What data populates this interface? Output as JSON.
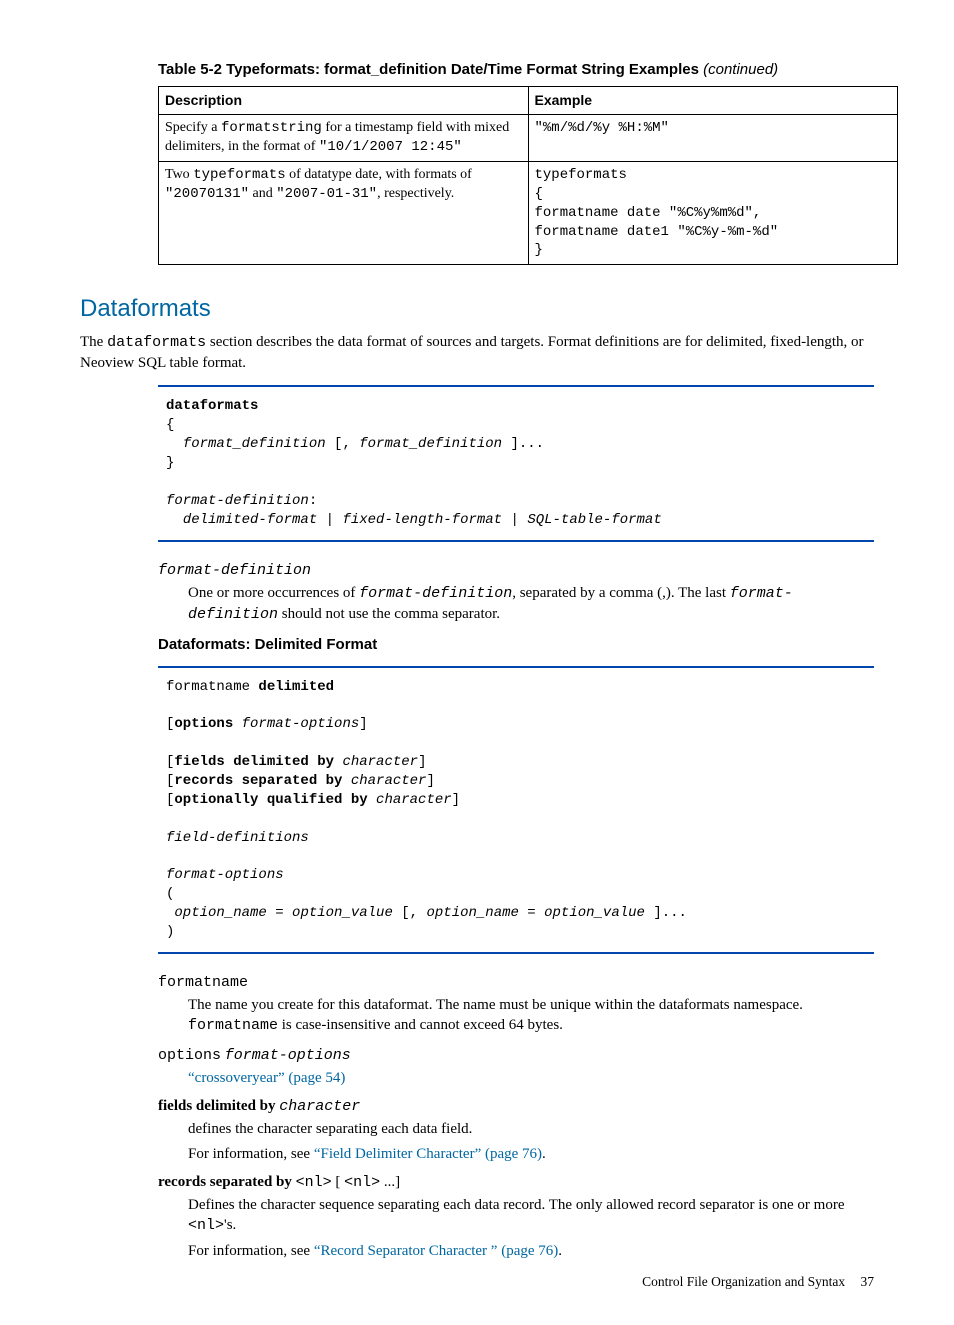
{
  "table": {
    "caption_prefix": "Table 5-2 Typeformats: format_definition Date/Time Format String Examples",
    "caption_suffix": "(continued)",
    "headers": {
      "desc": "Description",
      "ex": "Example"
    },
    "rows": [
      {
        "desc_pre": "Specify a ",
        "desc_code1": "formatstring",
        "desc_mid": " for a timestamp field with mixed delimiters, in the format of ",
        "desc_code2": "\"10/1/2007 12:45\"",
        "ex": "\"%m/%d/%y %H:%M\""
      },
      {
        "desc_pre": "Two ",
        "desc_code1": "typeformats",
        "desc_mid": " of datatype date, with formats of ",
        "desc_code2": "\"20070131\"",
        "desc_mid2": " and ",
        "desc_code3": "\"2007-01-31\"",
        "desc_post": ", respectively.",
        "ex": "typeformats\n{\nformatname date \"%C%y%m%d\",\nformatname date1 \"%C%y-%m-%d\"\n}"
      }
    ]
  },
  "section_heading": "Dataformats",
  "intro_pre": "The ",
  "intro_code": "dataformats",
  "intro_post": " section describes the data format of sources and targets. Format definitions are for delimited, fixed-length, or Neoview SQL table format.",
  "syntax1": {
    "l1_kw": "dataformats",
    "l2": "{",
    "l3_indent": "  ",
    "l3_var1": "format_definition",
    "l3_txt1": " [, ",
    "l3_var2": "format_definition",
    "l3_txt2": " ]...",
    "l4": "}",
    "l6_var": "format-definition",
    "l6_colon": ":",
    "l7_indent": "  ",
    "l7_var1": "delimited-format",
    "l7_bar1": " | ",
    "l7_var2": "fixed-length-format",
    "l7_bar2": " | ",
    "l7_var3": "SQL-table-format"
  },
  "term1": "format-definition",
  "def1_pre": "One or more occurrences of ",
  "def1_code1": "format-definition",
  "def1_mid": ", separated by a comma (,). The last ",
  "def1_code2": "format-definition",
  "def1_post": " should not use the comma separator.",
  "sub_heading": "Dataformats: Delimited Format",
  "syntax2": {
    "l1_txt": "formatname ",
    "l1_kw": "delimited",
    "l3_o": "[",
    "l3_kw": "options",
    "l3_sp": " ",
    "l3_var": "format-options",
    "l3_c": "]",
    "l5_o": "[",
    "l5_kw": "fields delimited by",
    "l5_sp": " ",
    "l5_var": "character",
    "l5_c": "]",
    "l6_o": "[",
    "l6_kw": "records separated by",
    "l6_sp": " ",
    "l6_var": "character",
    "l6_c": "]",
    "l7_o": "[",
    "l7_kw": "optionally qualified by",
    "l7_sp": " ",
    "l7_var": "character",
    "l7_c": "]",
    "l9_var": "field-definitions",
    "l11_var": "format-options",
    "l12": "(",
    "l13_indent": " ",
    "l13_var1": "option_name",
    "l13_eq1": " = ",
    "l13_var2": "option_value",
    "l13_txt1": " [, ",
    "l13_var3": "option_name",
    "l13_eq2": " = ",
    "l13_var4": "option_value",
    "l13_txt2": " ]...",
    "l14": ")"
  },
  "term2": "formatname",
  "def2_pre": "The name you create for this dataformat. The name must be unique within the dataformats namespace. ",
  "def2_code": "formatname",
  "def2_post": " is case-insensitive and cannot exceed 64 bytes.",
  "term3_code": "options",
  "term3_sp": " ",
  "term3_var": "format-options",
  "def3_link": "“crossoveryear” (page 54)",
  "term4_bold": "fields delimited by",
  "term4_sp": " ",
  "term4_var": "character",
  "def4a": "defines the character separating each data field.",
  "def4b_pre": "For information, see ",
  "def4b_link": "“Field Delimiter Character” (page 76)",
  "def4b_post": ".",
  "term5_bold": "records separated by",
  "term5_sp": " ",
  "term5_code1": "<nl>",
  "term5_txt1": " [ ",
  "term5_code2": "<nl>",
  "term5_txt2": " ...]",
  "def5a_pre": "Defines the character sequence separating each data record. The only allowed record separator is one or more ",
  "def5a_code": "<nl>",
  "def5a_post": "'s.",
  "def5b_pre": "For information, see ",
  "def5b_link": "“Record Separator Character ” (page 76)",
  "def5b_post": ".",
  "footer_text": "Control File Organization and Syntax",
  "footer_page": "37"
}
